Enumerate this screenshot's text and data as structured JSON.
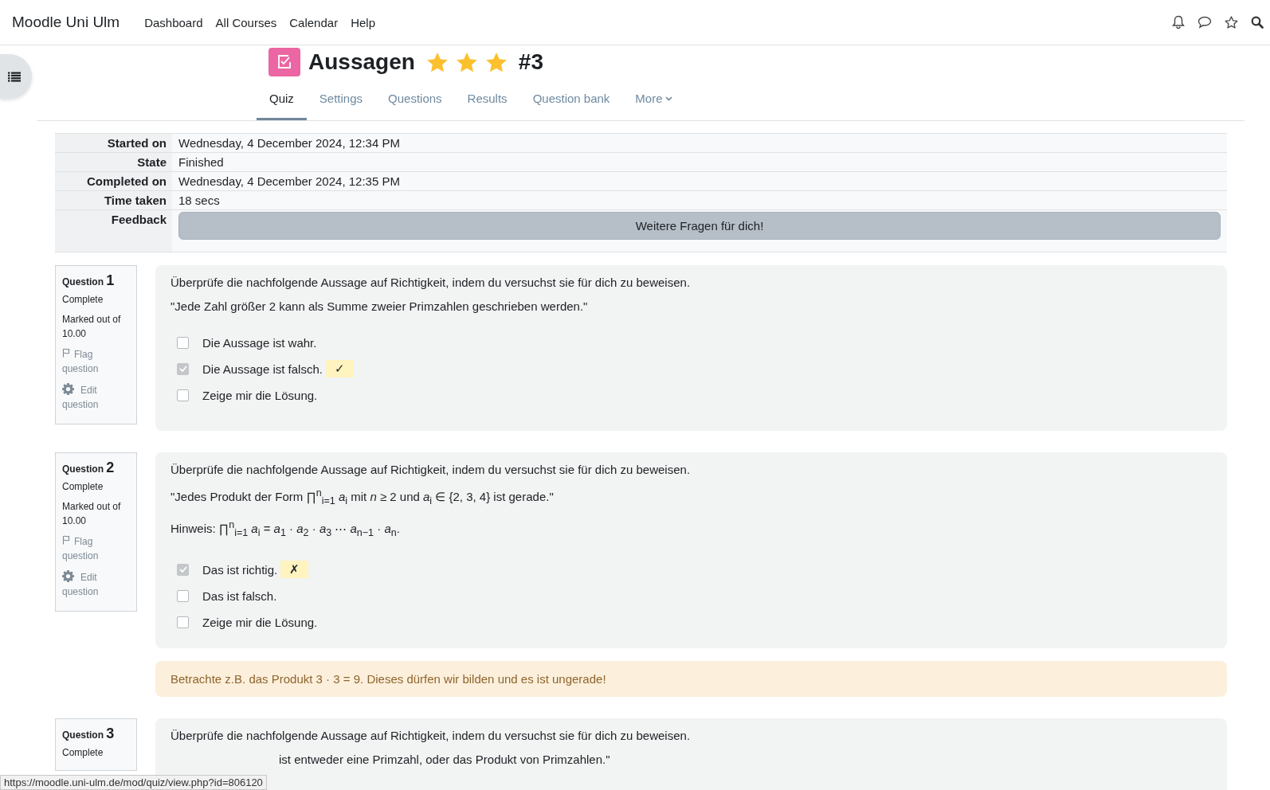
{
  "navbar": {
    "brand": "Moodle Uni Ulm",
    "links": [
      "Dashboard",
      "All Courses",
      "Calendar",
      "Help"
    ]
  },
  "title": {
    "text": "Aussagen",
    "stars": 3,
    "suffix": "#3"
  },
  "tabs": [
    {
      "label": "Quiz",
      "selected": true,
      "kind": "link"
    },
    {
      "label": "Settings",
      "selected": false,
      "kind": "link"
    },
    {
      "label": "Questions",
      "selected": false,
      "kind": "link"
    },
    {
      "label": "Results",
      "selected": false,
      "kind": "link"
    },
    {
      "label": "Question bank",
      "selected": false,
      "kind": "link"
    },
    {
      "label": "More",
      "selected": false,
      "kind": "dropdown"
    }
  ],
  "summary": [
    {
      "label": "Started on",
      "value": "Wednesday, 4 December 2024, 12:34 PM"
    },
    {
      "label": "State",
      "value": "Finished"
    },
    {
      "label": "Completed on",
      "value": "Wednesday, 4 December 2024, 12:35 PM"
    },
    {
      "label": "Time taken",
      "value": "18 secs"
    },
    {
      "label": "Feedback",
      "button": "Weitere Fragen für dich!"
    }
  ],
  "questions": [
    {
      "label": "Question",
      "number": "1",
      "state": "Complete",
      "marks": "Marked out of 10.00",
      "flag": "Flag question",
      "edit": "Edit question",
      "lines": [
        "Überprüfe die nachfolgende Aussage auf Richtigkeit, indem du versuchst sie für dich zu beweisen.",
        "\"Jede Zahl größer 2 kann als Summe zweier Primzahlen geschrieben werden.\""
      ],
      "options": [
        {
          "text": "Die Aussage ist wahr.",
          "checked": false
        },
        {
          "text": "Die Aussage ist falsch.",
          "checked": true,
          "mark": "✓"
        },
        {
          "text": "Zeige mir die Lösung.",
          "checked": false
        }
      ]
    },
    {
      "label": "Question",
      "number": "2",
      "state": "Complete",
      "marks": "Marked out of 10.00",
      "flag": "Flag question",
      "edit": "Edit question",
      "lines": [
        "Überprüfe die nachfolgende Aussage auf Richtigkeit, indem du versuchst sie für dich zu beweisen.",
        "\"Jedes Produkt der Form ∏$^{n}$$_{i=1}$ *a*$_{i}$ mit *n* ≥ 2 und *a*$_{i}$ ∈ {2, 3, 4} ist gerade.\"",
        "Hinweis: ∏$^{n}$$_{i=1}$ *a*$_{i}$ = *a*$_{1}$ · *a*$_{2}$ · *a*$_{3}$ ⋯ *a*$_{n−1}$ · *a*$_{n}$."
      ],
      "options": [
        {
          "text": "Das ist richtig.",
          "checked": true,
          "mark": "✗"
        },
        {
          "text": "Das ist falsch.",
          "checked": false
        },
        {
          "text": "Zeige mir die Lösung.",
          "checked": false
        }
      ],
      "outcome": "Betrachte z.B. das Produkt 3 · 3 = 9. Dieses dürfen wir bilden und es ist ungerade!"
    },
    {
      "label": "Question",
      "number": "3",
      "state": "Complete",
      "lines": [
        "Überprüfe die nachfolgende Aussage auf Richtigkeit, indem du versuchst sie für dich zu beweisen."
      ],
      "covered_line": "ist entweder eine Primzahl, oder das Produkt von Primzahlen.\""
    }
  ],
  "status_url": "https://moodle.uni-ulm.de/mod/quiz/view.php?id=806120"
}
